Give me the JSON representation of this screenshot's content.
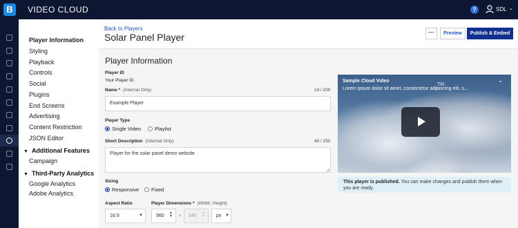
{
  "topbar": {
    "logo": "B",
    "brand": "VIDEO CLOUD",
    "help": "?",
    "user": "SDL"
  },
  "sidebar": {
    "items": [
      {
        "label": "Player Information",
        "active": true
      },
      {
        "label": "Styling"
      },
      {
        "label": "Playback"
      },
      {
        "label": "Controls"
      },
      {
        "label": "Social"
      },
      {
        "label": "Plugins"
      },
      {
        "label": "End Screens"
      },
      {
        "label": "Advertising"
      },
      {
        "label": "Content Restriction"
      },
      {
        "label": "JSON Editor"
      }
    ],
    "additional_features": {
      "title": "Additional Features",
      "items": [
        {
          "label": "Campaign"
        }
      ]
    },
    "third_party": {
      "title": "Third-Party Analytics",
      "items": [
        {
          "label": "Google Analytics"
        },
        {
          "label": "Adobe Analytics"
        }
      ]
    }
  },
  "header": {
    "back": "Back to Players",
    "title": "Solar Panel Player",
    "more": "···",
    "preview": "Preview",
    "publish": "Publish & Embed"
  },
  "form": {
    "section_title": "Player Information",
    "player_id": {
      "label": "Player ID",
      "value": "Your  Player ID"
    },
    "name": {
      "label": "Name *",
      "hint": "(Internal Only)",
      "counter": "14 / 200",
      "value": "Example Player"
    },
    "player_type": {
      "label": "Player Type",
      "options": [
        "Single Video",
        "Playlist"
      ],
      "selected": "Single Video"
    },
    "description": {
      "label": "Short Description",
      "hint": "(Internal Only)",
      "counter": "40 / 250",
      "value": "Player for the  solar panel demo website"
    },
    "sizing": {
      "label": "Sizing",
      "options": [
        "Responsive",
        "Fixed"
      ],
      "selected": "Responsive"
    },
    "aspect_ratio": {
      "label": "Aspect Ratio",
      "value": "16:9"
    },
    "dimensions": {
      "label": "Player Dimensions *",
      "hint": "(Width, Height)",
      "width": "960",
      "times": "×",
      "height": "540",
      "unit": "px"
    }
  },
  "preview": {
    "title": "Sample Cloud Video",
    "description": "Lorem ipsum dolor sit amet, consectetur adipiscing elit, s...",
    "tm": "TM"
  },
  "notice": {
    "bold": "This player is published.",
    "text": " You can make changes and publish them when you are ready."
  }
}
